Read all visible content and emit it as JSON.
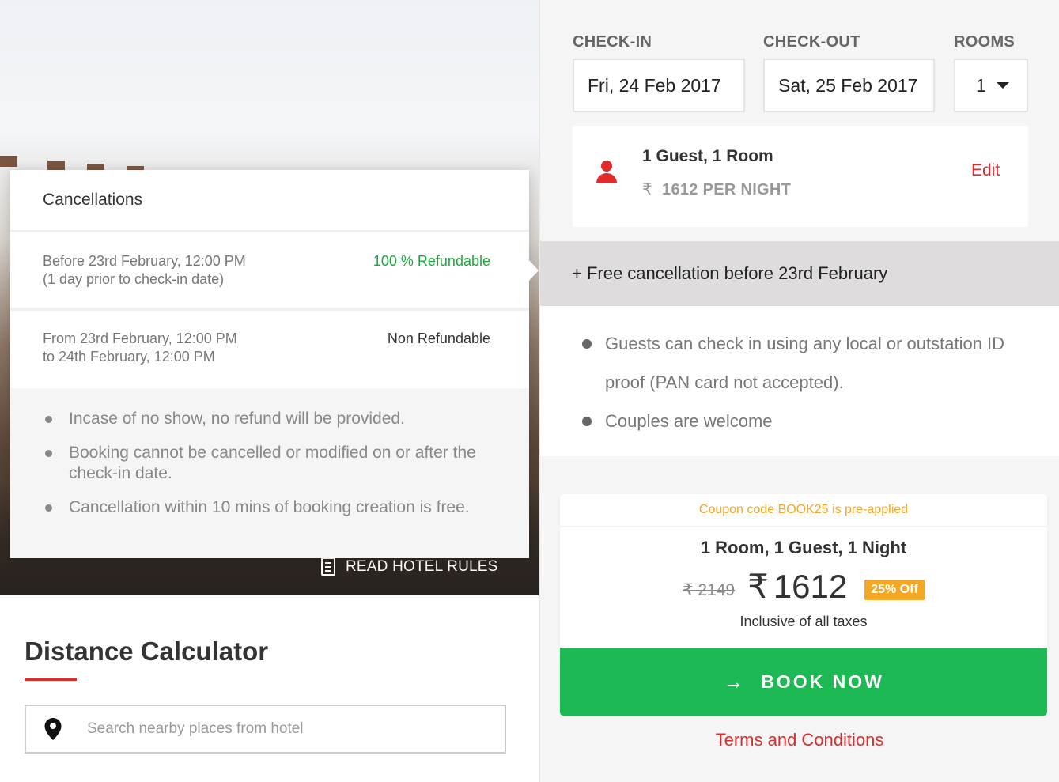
{
  "hotel_rules": {
    "read_rules_label": "READ HOTEL RULES"
  },
  "cancellations": {
    "title": "Cancellations",
    "rows": [
      {
        "date_line1": "Before 23rd February, 12:00 PM",
        "date_line2": "(1 day prior to check-in date)",
        "status": "100 % Refundable",
        "status_color": "#1aaa3c"
      },
      {
        "date_line1": "From 23rd February, 12:00 PM",
        "date_line2": "to 24th February, 12:00 PM",
        "status": "Non Refundable",
        "status_color": "#333333"
      }
    ],
    "notes": [
      "Incase of no show, no refund will be provided.",
      "Booking cannot be cancelled or modified on or after the check-in date.",
      "Cancellation within 10 mins of booking creation is free."
    ]
  },
  "distance_calculator": {
    "title": "Distance Calculator",
    "search_placeholder": "Search nearby places from hotel",
    "search_icon": "map-pin-icon"
  },
  "booking_form": {
    "checkin_label": "CHECK-IN",
    "checkout_label": "CHECK-OUT",
    "rooms_label": "ROOMS",
    "checkin_value": "Fri, 24 Feb 2017",
    "checkout_value": "Sat, 25 Feb 2017",
    "rooms_value": "1"
  },
  "guest_card": {
    "icon": "user-icon",
    "title": "1 Guest, 1 Room",
    "currency_symbol": "₹",
    "price_text": "1612 PER NIGHT",
    "edit_label": "Edit"
  },
  "free_cancellation": "+ Free cancellation before 23rd February",
  "policies": [
    "Guests can check in using any local or outstation ID proof (PAN card not accepted).",
    "Couples are welcome"
  ],
  "booking_summary": {
    "coupon_text": "Coupon code BOOK25 is pre-applied",
    "summary": "1 Room, 1 Guest, 1 Night",
    "old_price": "₹ 2149",
    "currency_symbol": "₹",
    "new_price": "1612",
    "discount_badge": "25% Off",
    "taxes_note": "Inclusive of all taxes",
    "book_button_label": "BOOK NOW",
    "book_button_icon": "arrow-right-icon"
  },
  "terms_label": "Terms and Conditions",
  "colors": {
    "accent_red": "#e02b2b",
    "book_green": "#1db954",
    "coupon_orange": "#f5a623",
    "refundable_green": "#1aaa3c"
  }
}
